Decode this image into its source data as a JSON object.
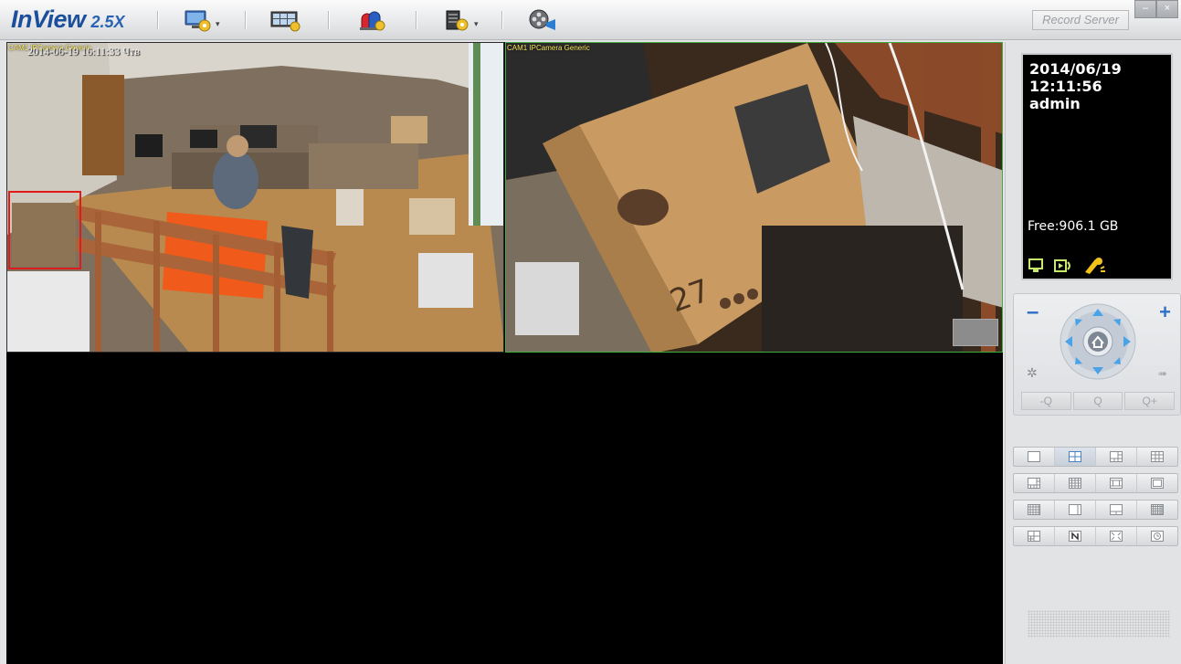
{
  "app": {
    "name": "InView",
    "version": "2.5X",
    "record_server_label": "Record Server",
    "window_controls": [
      "–",
      "×"
    ]
  },
  "toolbar": {
    "items": [
      {
        "icon": "monitor-settings-icon",
        "has_dropdown": true
      },
      {
        "icon": "video-wall-icon",
        "has_dropdown": false
      },
      {
        "icon": "alarm-icon",
        "has_dropdown": false
      },
      {
        "icon": "device-config-icon",
        "has_dropdown": true
      },
      {
        "icon": "playback-film-icon",
        "has_dropdown": false
      }
    ]
  },
  "cameras": [
    {
      "label": "CAM1 IPCamera Generic",
      "osd": "2014-06-19 16:11:33 Чтв",
      "selected": false
    },
    {
      "label": "CAM1 IPCamera Generic",
      "osd": "",
      "selected": true
    }
  ],
  "info": {
    "date": "2014/06/19",
    "time": "12:11:56",
    "user": "admin",
    "free_space": "Free:906.1 GB"
  },
  "ptz": {
    "zoom_minus": "–",
    "zoom_plus": "+",
    "zoom_buttons": [
      "-Q",
      "Q",
      "Q+"
    ]
  },
  "colors": {
    "accent_blue": "#1b4f9c",
    "selected_border": "#3fae3f",
    "motion_box": "#e11a1a"
  }
}
